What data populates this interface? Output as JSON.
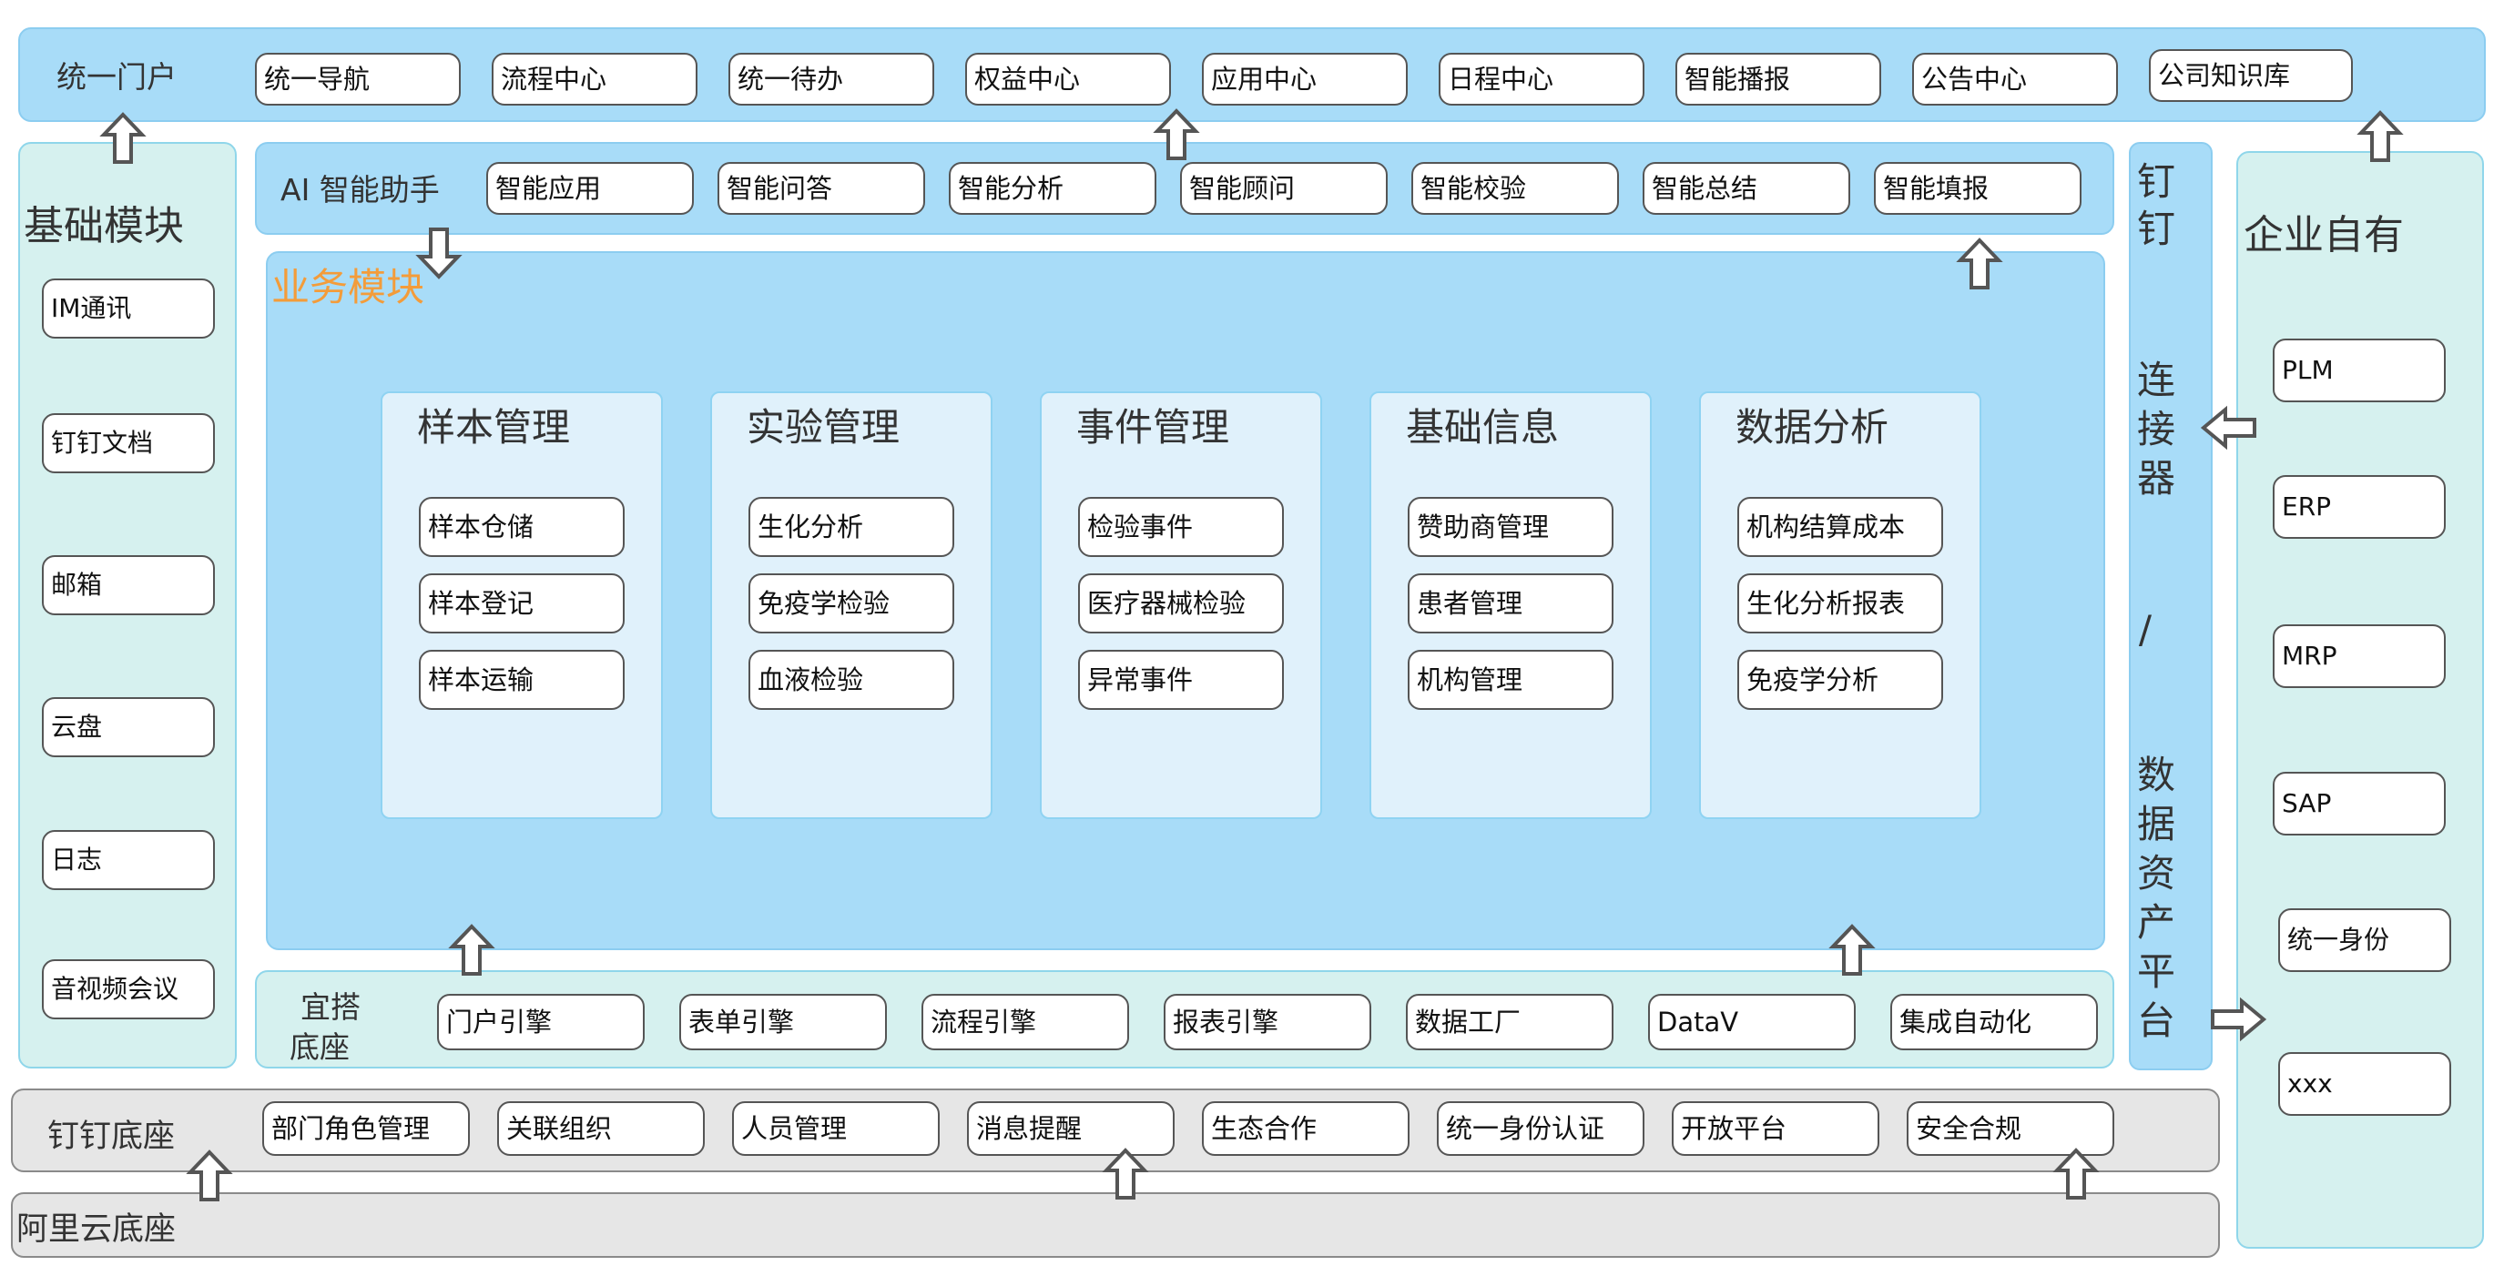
{
  "portal": {
    "title": "统一门户",
    "items": [
      "统一导航",
      "流程中心",
      "统一待办",
      "权益中心",
      "应用中心",
      "日程中心",
      "智能播报",
      "公告中心",
      "公司知识库"
    ]
  },
  "ai_assistant": {
    "title": "AI 智能助手",
    "items": [
      "智能应用",
      "智能问答",
      "智能分析",
      "智能顾问",
      "智能校验",
      "智能总结",
      "智能填报"
    ]
  },
  "base_modules": {
    "title": "基础模块",
    "items": [
      "IM通讯",
      "钉钉文档",
      "邮箱",
      "云盘",
      "日志",
      "音视频会议"
    ]
  },
  "business": {
    "title": "业务模块",
    "groups": [
      {
        "title": "样本管理",
        "items": [
          "样本仓储",
          "样本登记",
          "样本运输"
        ]
      },
      {
        "title": "实验管理",
        "items": [
          "生化分析",
          "免疫学检验",
          "血液检验"
        ]
      },
      {
        "title": "事件管理",
        "items": [
          "检验事件",
          "医疗器械检验",
          "异常事件"
        ]
      },
      {
        "title": "基础信息",
        "items": [
          "赞助商管理",
          "患者管理",
          "机构管理"
        ]
      },
      {
        "title": "数据分析",
        "items": [
          "机构结算成本",
          "生化分析报表",
          "免疫学分析"
        ]
      }
    ]
  },
  "yida": {
    "title_line1": "宜搭",
    "title_line2": "底座",
    "items": [
      "门户引擎",
      "表单引擎",
      "流程引擎",
      "报表引擎",
      "数据工厂",
      "DataV",
      "集成自动化"
    ]
  },
  "connector": {
    "chars": [
      "钉",
      "钉",
      "连",
      "接",
      "器",
      "/",
      "数",
      "据",
      "资",
      "产",
      "平",
      "台"
    ]
  },
  "enterprise": {
    "title": "企业自有",
    "items": [
      "PLM",
      "ERP",
      "MRP",
      "SAP",
      "统一身份",
      "xxx"
    ]
  },
  "dingtalk_base": {
    "title": "钉钉底座",
    "items": [
      "部门角色管理",
      "关联组织",
      "人员管理",
      "消息提醒",
      "生态合作",
      "统一身份认证",
      "开放平台",
      "安全合规"
    ]
  },
  "aliyun": {
    "title": "阿里云底座"
  },
  "colors": {
    "blue_band": "#a8dcf8",
    "green_band": "#d6f1ef",
    "gray_band": "#e6e6e6",
    "business_title": "#f39c3a"
  }
}
